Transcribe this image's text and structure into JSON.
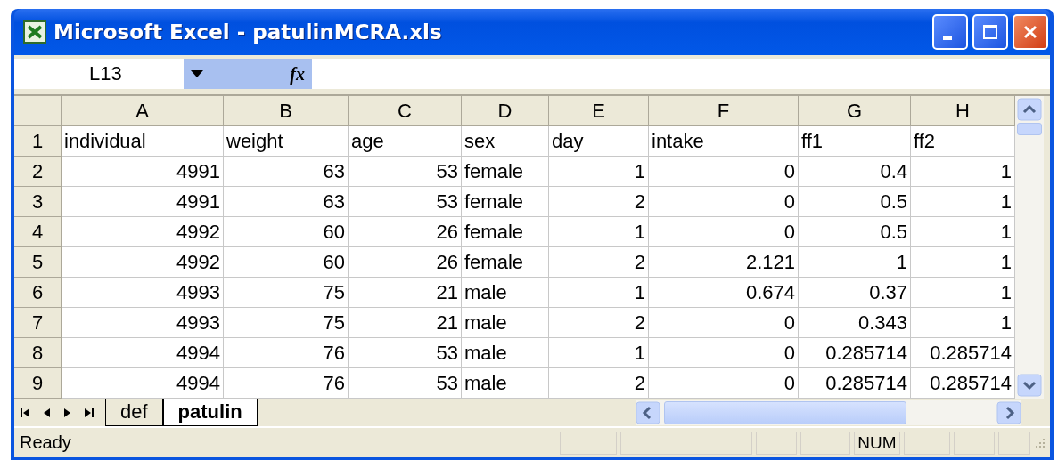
{
  "window": {
    "title": "Microsoft Excel - patulinMCRA.xls"
  },
  "formula_bar": {
    "name_box": "L13",
    "function_label": "fx"
  },
  "columns": [
    {
      "label": "A",
      "kind": "number"
    },
    {
      "label": "B",
      "kind": "number"
    },
    {
      "label": "C",
      "kind": "number"
    },
    {
      "label": "D",
      "kind": "text"
    },
    {
      "label": "E",
      "kind": "number"
    },
    {
      "label": "F",
      "kind": "number"
    },
    {
      "label": "G",
      "kind": "number"
    },
    {
      "label": "H",
      "kind": "number"
    }
  ],
  "rows": [
    {
      "number": "1",
      "kind": "labels",
      "cells": [
        "individual",
        "weight",
        "age",
        "sex",
        "day",
        "intake",
        "ff1",
        "ff2"
      ]
    },
    {
      "number": "2",
      "kind": "values",
      "cells": [
        "4991",
        "63",
        "53",
        "female",
        "1",
        "0",
        "0.4",
        "1"
      ]
    },
    {
      "number": "3",
      "kind": "values",
      "cells": [
        "4991",
        "63",
        "53",
        "female",
        "2",
        "0",
        "0.5",
        "1"
      ]
    },
    {
      "number": "4",
      "kind": "values",
      "cells": [
        "4992",
        "60",
        "26",
        "female",
        "1",
        "0",
        "0.5",
        "1"
      ]
    },
    {
      "number": "5",
      "kind": "values",
      "cells": [
        "4992",
        "60",
        "26",
        "female",
        "2",
        "2.121",
        "1",
        "1"
      ]
    },
    {
      "number": "6",
      "kind": "values",
      "cells": [
        "4993",
        "75",
        "21",
        "male",
        "1",
        "0.674",
        "0.37",
        "1"
      ]
    },
    {
      "number": "7",
      "kind": "values",
      "cells": [
        "4993",
        "75",
        "21",
        "male",
        "2",
        "0",
        "0.343",
        "1"
      ]
    },
    {
      "number": "8",
      "kind": "values",
      "cells": [
        "4994",
        "76",
        "53",
        "male",
        "1",
        "0",
        "0.285714",
        "0.285714"
      ]
    },
    {
      "number": "9",
      "kind": "values",
      "cells": [
        "4994",
        "76",
        "53",
        "male",
        "2",
        "0",
        "0.285714",
        "0.285714"
      ]
    }
  ],
  "sheet_tabs": [
    {
      "label": "def",
      "selected": false
    },
    {
      "label": "patulin",
      "selected": true
    }
  ],
  "status_bar": {
    "status": "Ready",
    "num_lock": "NUM"
  }
}
